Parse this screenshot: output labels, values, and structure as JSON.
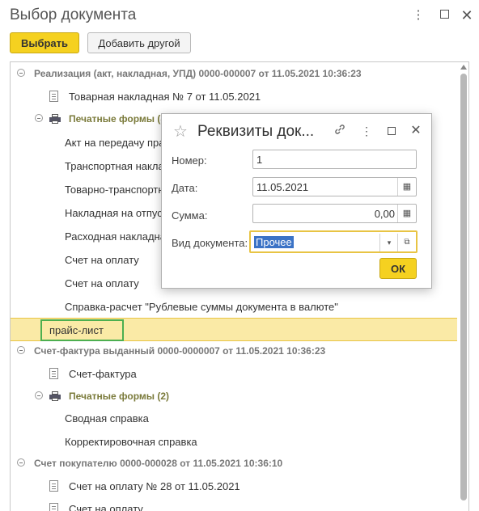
{
  "window": {
    "title": "Выбор документа"
  },
  "toolbar": {
    "select_label": "Выбрать",
    "add_other_label": "Добавить другой"
  },
  "tree": {
    "rows": [
      {
        "kind": "group",
        "text": "Реализация (акт, накладная, УПД) 0000-000007 от 11.05.2021 10:36:23"
      },
      {
        "kind": "doc",
        "text": "Товарная накладная № 7 от 11.05.2021"
      },
      {
        "kind": "print",
        "text": "Печатные формы (8)"
      },
      {
        "kind": "item",
        "text": "Акт на передачу прав"
      },
      {
        "kind": "item",
        "text": "Транспортная накладная"
      },
      {
        "kind": "item",
        "text": "Товарно-транспортная накладная"
      },
      {
        "kind": "item",
        "text": "Накладная на отпуск материалов"
      },
      {
        "kind": "item",
        "text": "Расходная накладная"
      },
      {
        "kind": "item",
        "text": "Счет на оплату"
      },
      {
        "kind": "item",
        "text": "Счет на оплату"
      },
      {
        "kind": "item",
        "text": "Справка-расчет \"Рублевые суммы документа в валюте\""
      },
      {
        "kind": "selected",
        "text": "прайс-лист"
      },
      {
        "kind": "group",
        "text": "Счет-фактура выданный 0000-0000007 от 11.05.2021 10:36:23"
      },
      {
        "kind": "doc",
        "text": "Счет-фактура"
      },
      {
        "kind": "print",
        "text": "Печатные формы (2)"
      },
      {
        "kind": "item",
        "text": "Сводная справка"
      },
      {
        "kind": "item",
        "text": "Корректировочная справка"
      },
      {
        "kind": "group",
        "text": "Счет покупателю 0000-000028 от 11.05.2021 10:36:10"
      },
      {
        "kind": "doc",
        "text": "Счет на оплату № 28 от 11.05.2021"
      },
      {
        "kind": "item",
        "text": "Счет на оплату"
      }
    ]
  },
  "dialog": {
    "title": "Реквизиты док...",
    "number_label": "Номер:",
    "number_value": "1",
    "date_label": "Дата:",
    "date_value": "11.05.2021",
    "sum_label": "Сумма:",
    "sum_value": "0,00",
    "doctype_label": "Вид документа:",
    "doctype_value": "Прочее",
    "ok_label": "ОК"
  }
}
